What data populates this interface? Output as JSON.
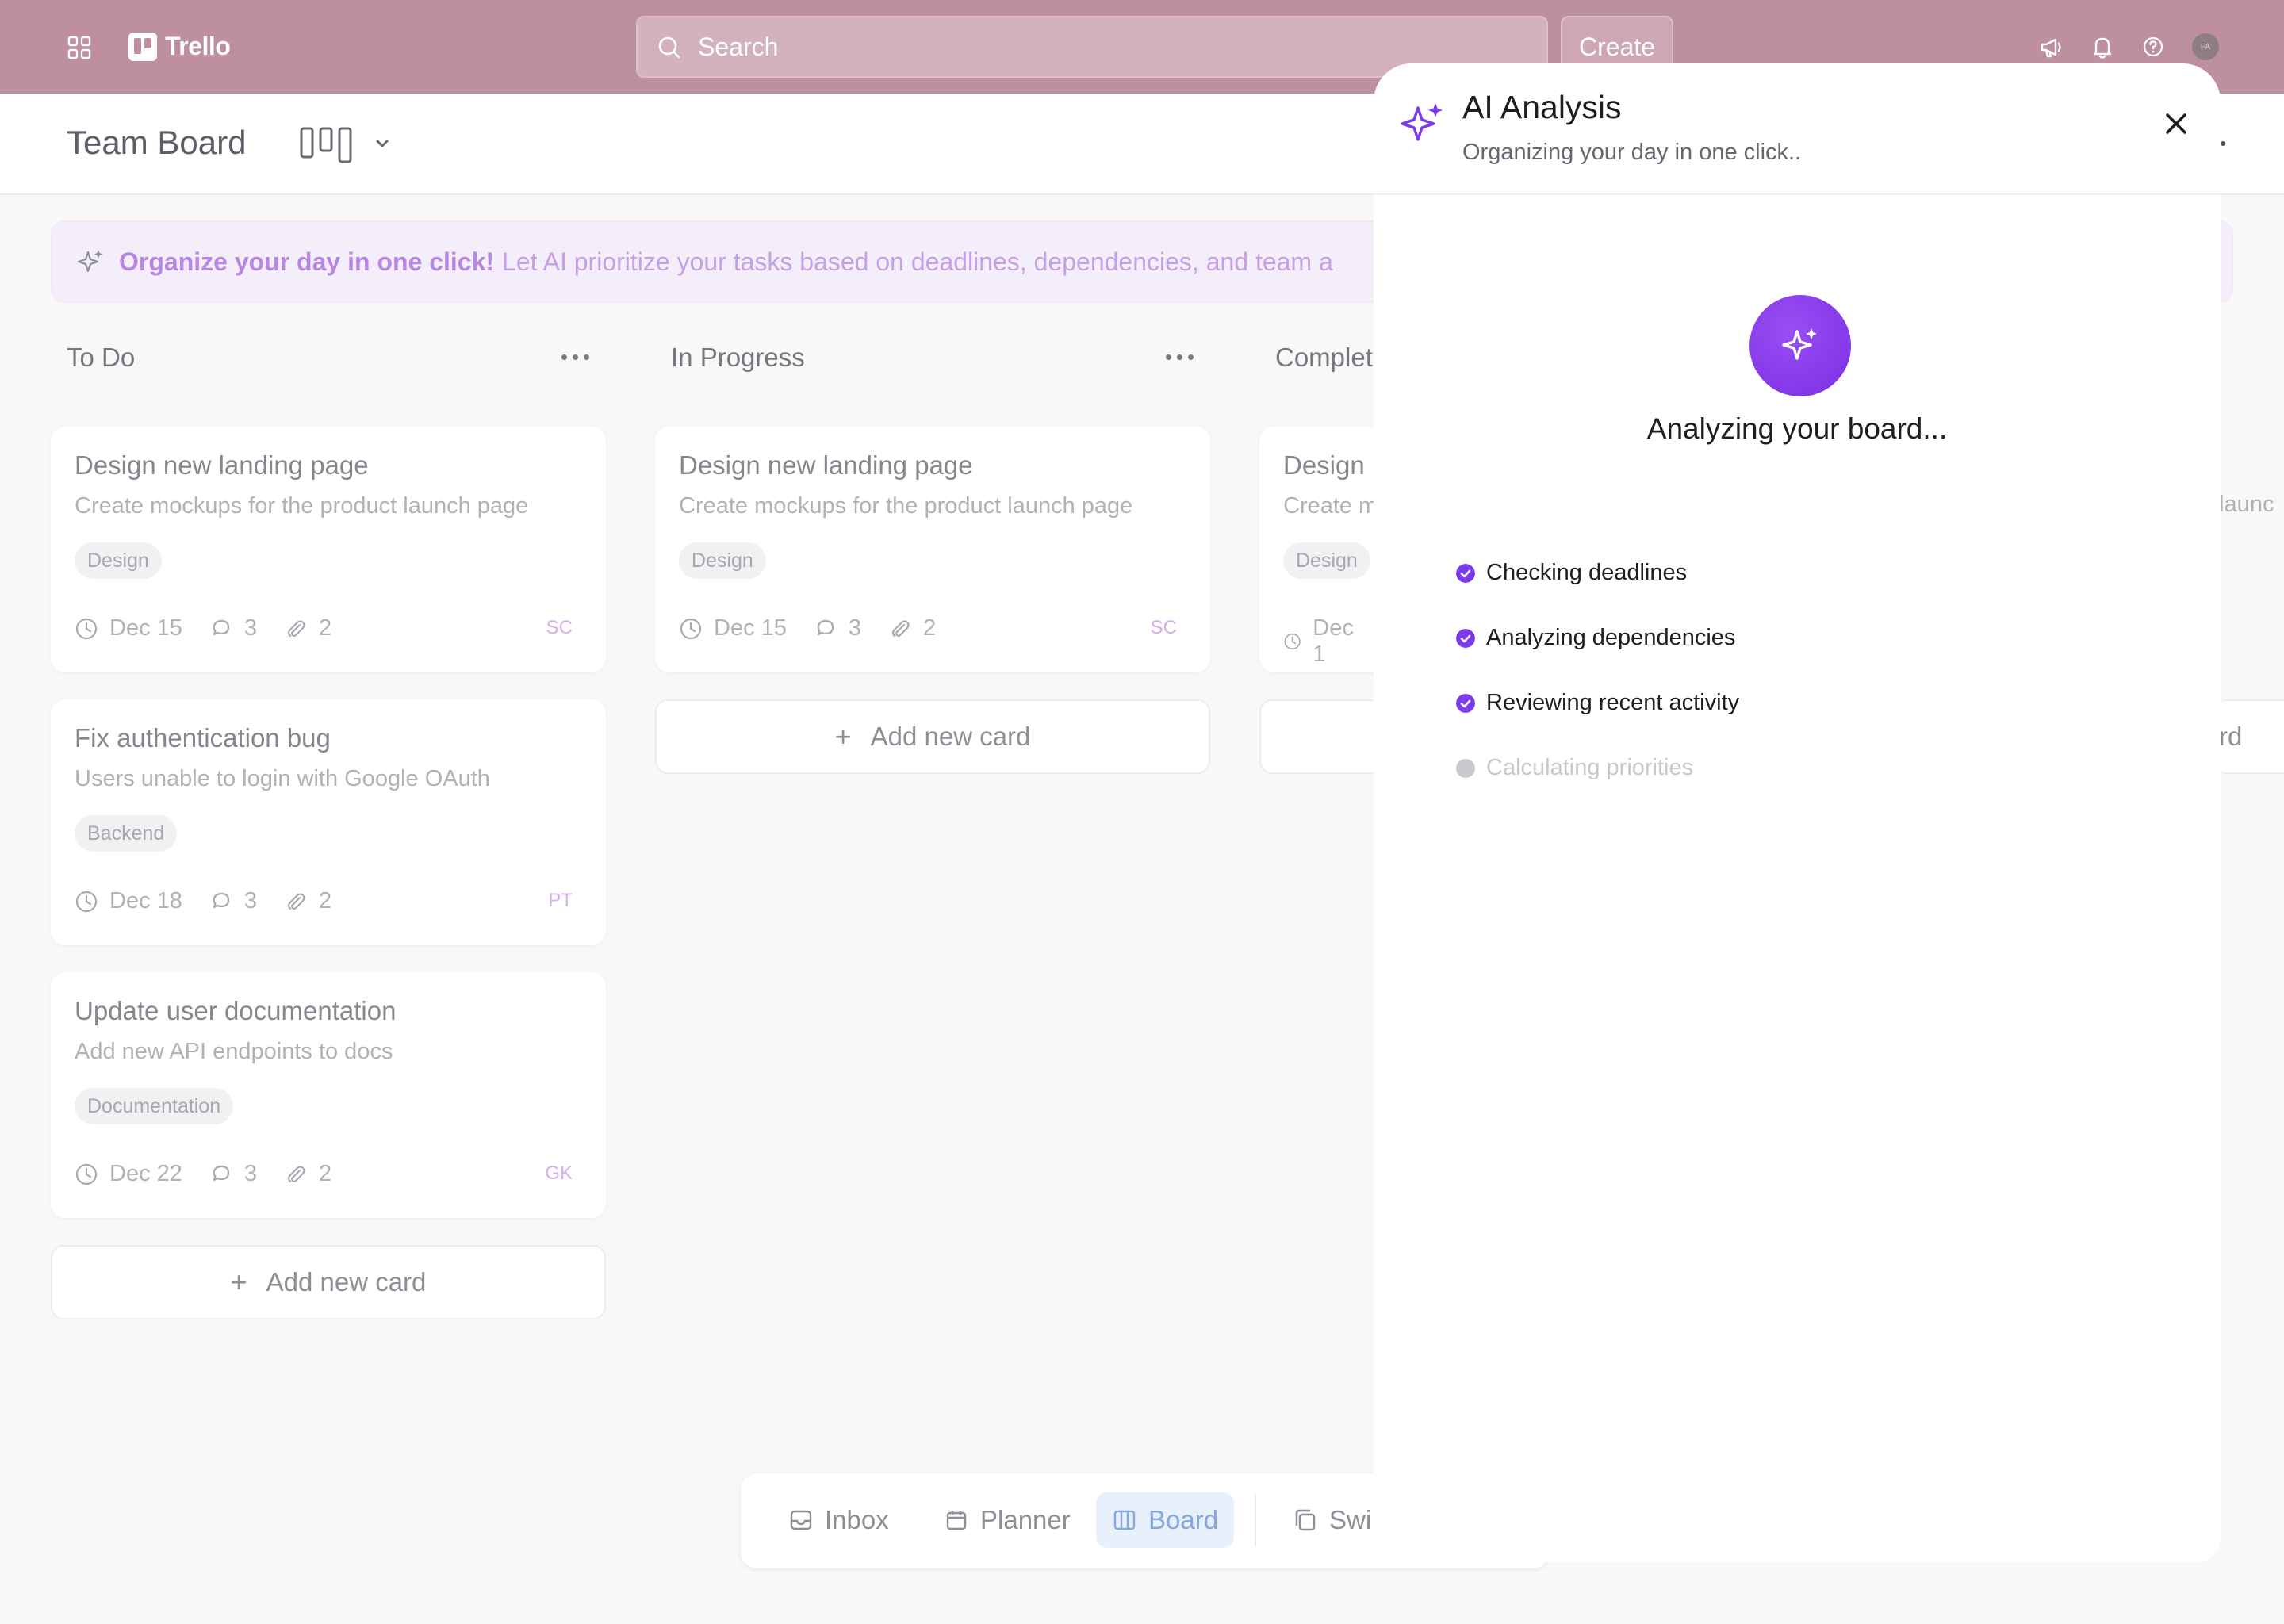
{
  "topbar": {
    "brand": "Trello",
    "search_placeholder": "Search",
    "create_label": "Create",
    "avatar_initials": "FA"
  },
  "board": {
    "title": "Team Board"
  },
  "banner": {
    "strong": "Organize your day in one click!",
    "text": "Let AI prioritize your tasks based on deadlines, dependencies, and team a"
  },
  "columns": [
    {
      "title": "To Do",
      "cards": [
        {
          "title": "Design new landing page",
          "desc": "Create mockups for the product launch page",
          "tag": "Design",
          "date": "Dec 15",
          "comments": "3",
          "attachments": "2",
          "assignee": "SC"
        },
        {
          "title": "Fix authentication bug",
          "desc": "Users unable to login with Google OAuth",
          "tag": "Backend",
          "date": "Dec 18",
          "comments": "3",
          "attachments": "2",
          "assignee": "PT"
        },
        {
          "title": "Update user documentation",
          "desc": "Add new API endpoints to docs",
          "tag": "Documentation",
          "date": "Dec 22",
          "comments": "3",
          "attachments": "2",
          "assignee": "GK"
        }
      ],
      "add_label": "Add new card"
    },
    {
      "title": "In Progress",
      "cards": [
        {
          "title": "Design new landing page",
          "desc": "Create mockups for the product launch page",
          "tag": "Design",
          "date": "Dec 15",
          "comments": "3",
          "attachments": "2",
          "assignee": "SC"
        }
      ],
      "add_label": "Add new card"
    },
    {
      "title": "Complet",
      "cards": [
        {
          "title": "Design",
          "desc": "Create m",
          "tag": "Design",
          "date": "Dec 1"
        }
      ]
    }
  ],
  "peek": {
    "desc_tail": "t launc",
    "add_tail": "rd"
  },
  "bottom_nav": {
    "inbox": "Inbox",
    "planner": "Planner",
    "board": "Board",
    "switch": "Swi"
  },
  "modal": {
    "title": "AI Analysis",
    "subtitle": "Organizing your day in one click..",
    "status": "Analyzing your board...",
    "steps": [
      {
        "label": "Checking deadlines",
        "state": "done"
      },
      {
        "label": "Analyzing dependencies",
        "state": "done"
      },
      {
        "label": "Reviewing recent activity",
        "state": "done"
      },
      {
        "label": "Calculating priorities",
        "state": "pending"
      }
    ]
  },
  "colors": {
    "topbar": "#be8ea1",
    "accent_purple": "#7c3aed",
    "pending_gray": "#c7c7cc"
  }
}
